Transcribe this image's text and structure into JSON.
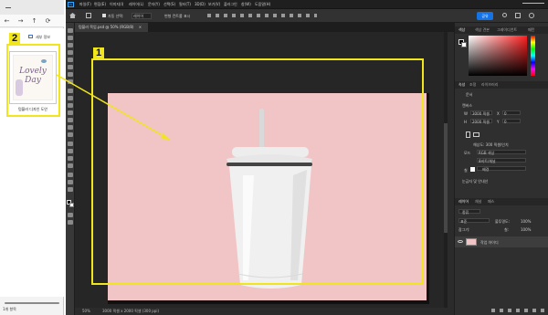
{
  "explorer": {
    "nav_buttons": [
      "←",
      "→",
      "↑",
      "⟳"
    ],
    "view_label": "세부 정보",
    "file": {
      "name": "텀블러 디자인 도안",
      "thumb_lines": [
        "Lovely",
        "Day"
      ]
    },
    "status": "1개 항목"
  },
  "photoshop": {
    "logo": "Ps",
    "menu": [
      "파일(F)",
      "편집(E)",
      "이미지(I)",
      "레이어(L)",
      "문자(Y)",
      "선택(S)",
      "필터(T)",
      "3D(D)",
      "보기(V)",
      "플러그인",
      "창(W)",
      "도움말(H)"
    ],
    "options": {
      "auto_select": "자동 선택:",
      "target": "레이어",
      "transform": "변형 컨트롤 표시"
    },
    "share": "공유",
    "doc_tab": "텀블러 목업.psd @ 50% (RGB/8)",
    "status": {
      "zoom": "50%",
      "size": "3000 픽셀 x 2000 픽셀 (300 ppi)"
    },
    "color_tabs": [
      "색상",
      "색상 견본",
      "그레이디언트",
      "패턴"
    ],
    "props_tabs": [
      "속성",
      "조정",
      "라이브러리"
    ],
    "props": {
      "doc_label": "문서",
      "canvas": "캔버스",
      "w": "3000 픽셀",
      "h": "2000 픽셀",
      "x": "0",
      "y": "0",
      "resolution": "해상도: 300 픽셀/인치",
      "mode_label": "모드",
      "mode": "RGB 색상",
      "bits": "8비트/채널",
      "fill_label": "칠",
      "fill": "배경",
      "rulers": "눈금자 및 안내선"
    },
    "layers_tabs": [
      "레이어",
      "채널",
      "패스"
    ],
    "layers": {
      "kind": "종류",
      "blend": "표준",
      "opacity_label": "불투명도:",
      "opacity": "100%",
      "lock": "잠그기:",
      "fill_label": "칠:",
      "fill": "100%",
      "layer_name": "작업 아이디"
    },
    "colors": {
      "accent": "#f1e51b",
      "bg_pink": "#f1c4c5",
      "ps_blue": "#1473e6"
    }
  },
  "callouts": {
    "one": "1",
    "two": "2"
  }
}
